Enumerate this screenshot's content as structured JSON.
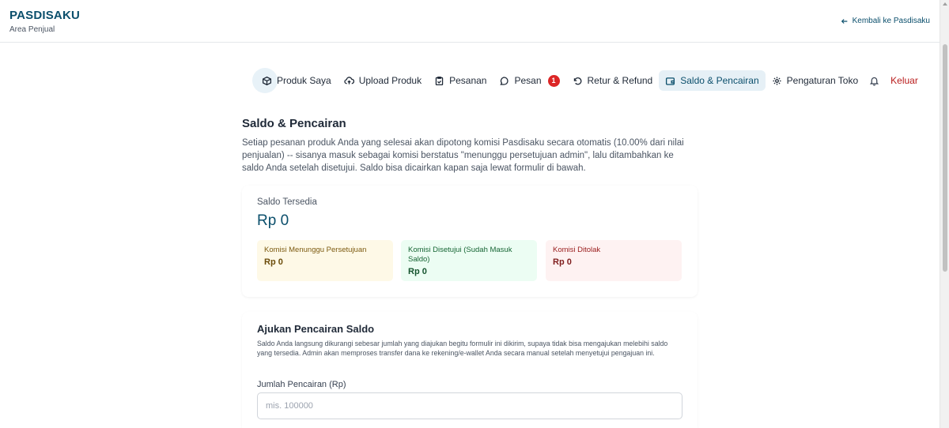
{
  "header": {
    "brand": "PASDISAKU",
    "subtitle": "Area Penjual",
    "back_link": "Kembali ke Pasdisaku"
  },
  "nav": {
    "items": [
      {
        "label": "Produk Saya",
        "icon": "box-icon"
      },
      {
        "label": "Upload Produk",
        "icon": "cloud-upload-icon"
      },
      {
        "label": "Pesanan",
        "icon": "clipboard-icon"
      },
      {
        "label": "Pesan",
        "icon": "chat-icon",
        "badge": "1"
      },
      {
        "label": "Retur & Refund",
        "icon": "undo-icon"
      },
      {
        "label": "Saldo & Pencairan",
        "icon": "wallet-icon",
        "active": true
      },
      {
        "label": "Pengaturan Toko",
        "icon": "gear-icon"
      }
    ],
    "logout": "Keluar"
  },
  "page": {
    "title": "Saldo & Pencairan",
    "description": "Setiap pesanan produk Anda yang selesai akan dipotong komisi Pasdisaku secara otomatis (10.00% dari nilai penjualan) -- sisanya masuk sebagai komisi berstatus \"menunggu persetujuan admin\", lalu ditambahkan ke saldo Anda setelah disetujui. Saldo bisa dicairkan kapan saja lewat formulir di bawah."
  },
  "balance": {
    "label": "Saldo Tersedia",
    "value": "Rp 0",
    "stats": {
      "pending": {
        "label": "Komisi Menunggu Persetujuan",
        "value": "Rp 0"
      },
      "approved": {
        "label": "Komisi Disetujui (Sudah Masuk Saldo)",
        "value": "Rp 0"
      },
      "rejected": {
        "label": "Komisi Ditolak",
        "value": "Rp 0"
      }
    }
  },
  "withdraw": {
    "title": "Ajukan Pencairan Saldo",
    "description": "Saldo Anda langsung dikurangi sebesar jumlah yang diajukan begitu formulir ini dikirim, supaya tidak bisa mengajukan melebihi saldo yang tersedia. Admin akan memproses transfer dana ke rekening/e-wallet Anda secara manual setelah menyetujui pengajuan ini.",
    "amount_label": "Jumlah Pencairan (Rp)",
    "amount_placeholder": "mis. 100000",
    "amount_value": ""
  },
  "colors": {
    "brand": "#0b4f6c",
    "badge": "#dc2626",
    "logout": "#b91c1c"
  }
}
